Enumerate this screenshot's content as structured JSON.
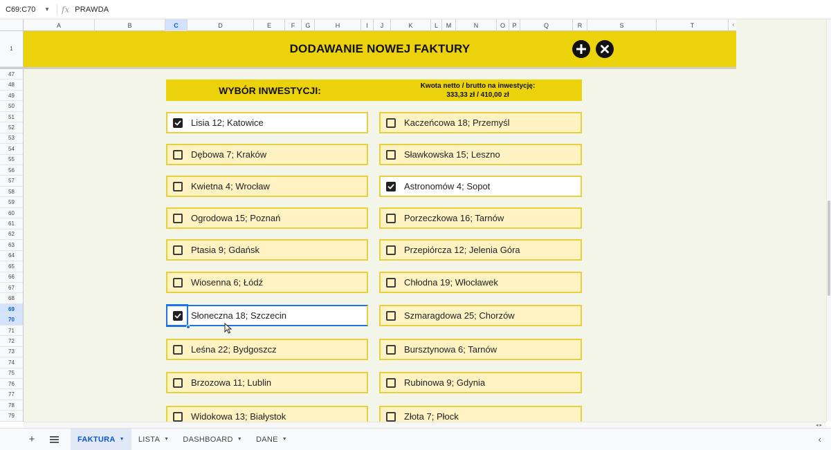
{
  "formula_bar": {
    "name_box": "C69:C70",
    "fx": "fx",
    "value": "PRAWDA"
  },
  "columns": [
    "A",
    "B",
    "C",
    "D",
    "E",
    "F",
    "G",
    "H",
    "I",
    "J",
    "K",
    "L",
    "M",
    "N",
    "O",
    "P",
    "Q",
    "R",
    "S",
    "T"
  ],
  "active_column": "C",
  "frozen_row": "1",
  "rows": [
    "47",
    "48",
    "49",
    "50",
    "51",
    "52",
    "53",
    "54",
    "55",
    "56",
    "57",
    "58",
    "59",
    "60",
    "61",
    "62",
    "63",
    "64",
    "65",
    "66",
    "67",
    "68",
    "69",
    "70",
    "71",
    "72",
    "73",
    "74",
    "75",
    "76",
    "77",
    "78",
    "79"
  ],
  "active_rows": [
    "69",
    "70"
  ],
  "banner": {
    "title": "DODAWANIE NOWEJ FAKTURY",
    "add_icon": "plus-icon",
    "close_icon": "close-icon"
  },
  "section": {
    "left_title": "WYBÓR INWESTYCJI:",
    "right_line1": "Kwota netto / brutto na inwestycję:",
    "right_line2": "333,33 zł / 410,00 zł"
  },
  "investments_left": [
    {
      "label": "Lisia 12; Katowice",
      "checked": true
    },
    {
      "label": "Dębowa 7; Kraków",
      "checked": false
    },
    {
      "label": "Kwietna 4; Wrocław",
      "checked": false
    },
    {
      "label": "Ogrodowa 15; Poznań",
      "checked": false
    },
    {
      "label": "Ptasia 9; Gdańsk",
      "checked": false
    },
    {
      "label": "Wiosenna 6; Łódź",
      "checked": false
    },
    {
      "label": "Słoneczna 18; Szczecin",
      "checked": true
    },
    {
      "label": "Leśna 22; Bydgoszcz",
      "checked": false
    },
    {
      "label": "Brzozowa 11; Lublin",
      "checked": false
    },
    {
      "label": "Widokowa 13; Białystok",
      "checked": false
    }
  ],
  "investments_right": [
    {
      "label": "Kaczeńcowa 18; Przemyśl",
      "checked": false
    },
    {
      "label": "Sławkowska 15; Leszno",
      "checked": false
    },
    {
      "label": "Astronomów 4; Sopot",
      "checked": true
    },
    {
      "label": "Porzeczkowa 16; Tarnów",
      "checked": false
    },
    {
      "label": "Przepiórcza 12; Jelenia Góra",
      "checked": false
    },
    {
      "label": "Chłodna 19; Włocławek",
      "checked": false
    },
    {
      "label": "Szmaragdowa 25; Chorzów",
      "checked": false
    },
    {
      "label": "Bursztynowa 6; Tarnów",
      "checked": false
    },
    {
      "label": "Rubinowa 9; Gdynia",
      "checked": false
    },
    {
      "label": "Złota 7; Płock",
      "checked": false
    }
  ],
  "sheet_tabs": [
    {
      "label": "FAKTURA",
      "active": true
    },
    {
      "label": "LISTA",
      "active": false
    },
    {
      "label": "DASHBOARD",
      "active": false
    },
    {
      "label": "DANE",
      "active": false
    }
  ],
  "colors": {
    "banner": "#ebd20a",
    "item_bg": "#fff3c4",
    "item_border": "#e8cf3b",
    "selection": "#1a73e8"
  }
}
